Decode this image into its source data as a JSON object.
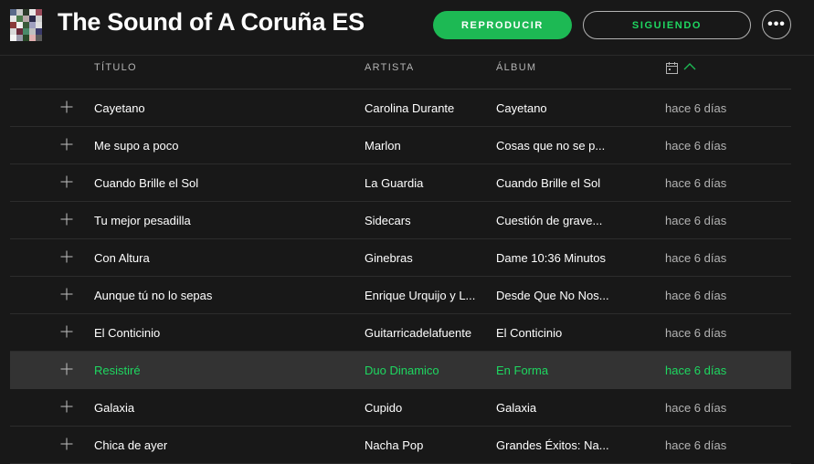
{
  "playlist": {
    "title": "The Sound of A Coruña ES",
    "cover_colors": [
      "#5a6a8a",
      "#c8c8c8",
      "#2d3a2a",
      "#e8e8e8",
      "#9a4a5a",
      "#e6e6e6",
      "#4a7a4a",
      "#b8a8a8",
      "#2a2a4a",
      "#d0d0d0",
      "#8a3a3a",
      "#f0f0f0",
      "#3a5a3a",
      "#a0a0c0",
      "#e0e0e0",
      "#d8d8d8",
      "#6a2a3a",
      "#4a8a6a",
      "#c0c0c0",
      "#3a3a6a",
      "#f4f4f4",
      "#9a9aaa",
      "#2a4a2a",
      "#e2b0b0",
      "#5a5a5a"
    ]
  },
  "actions": {
    "play_label": "REPRODUCIR",
    "follow_label": "SIGUIENDO",
    "more_label": "•••"
  },
  "columns": {
    "title": "TÍTULO",
    "artist": "ARTISTA",
    "album": "ÁLBUM",
    "date_icon": "calendar-icon",
    "sort_icon": "chevron-up-icon"
  },
  "colors": {
    "accent": "#1db954",
    "background": "#181818",
    "selected_row": "#333333",
    "text_muted": "#b3b3b3"
  },
  "tracks": [
    {
      "title": "Cayetano",
      "artist": "Carolina Durante",
      "album": "Cayetano",
      "added": "hace 6 días"
    },
    {
      "title": "Me supo a poco",
      "artist": "Marlon",
      "album": "Cosas que no se p...",
      "added": "hace 6 días"
    },
    {
      "title": "Cuando Brille el Sol",
      "artist": "La Guardia",
      "album": "Cuando Brille el Sol",
      "added": "hace 6 días"
    },
    {
      "title": "Tu mejor pesadilla",
      "artist": "Sidecars",
      "album": "Cuestión de grave...",
      "added": "hace 6 días"
    },
    {
      "title": "Con Altura",
      "artist": "Ginebras",
      "album": "Dame 10:36 Minutos",
      "added": "hace 6 días"
    },
    {
      "title": "Aunque tú no lo sepas",
      "artist": "Enrique Urquijo y L...",
      "album": "Desde Que No Nos...",
      "added": "hace 6 días"
    },
    {
      "title": "El Conticinio",
      "artist": "Guitarricadelafuente",
      "album": "El Conticinio",
      "added": "hace 6 días"
    },
    {
      "title": "Resistiré",
      "artist": "Duo Dinamico",
      "album": "En Forma",
      "added": "hace 6 días",
      "selected": true
    },
    {
      "title": "Galaxia",
      "artist": "Cupido",
      "album": "Galaxia",
      "added": "hace 6 días"
    },
    {
      "title": "Chica de ayer",
      "artist": "Nacha Pop",
      "album": "Grandes Éxitos: Na...",
      "added": "hace 6 días"
    }
  ]
}
